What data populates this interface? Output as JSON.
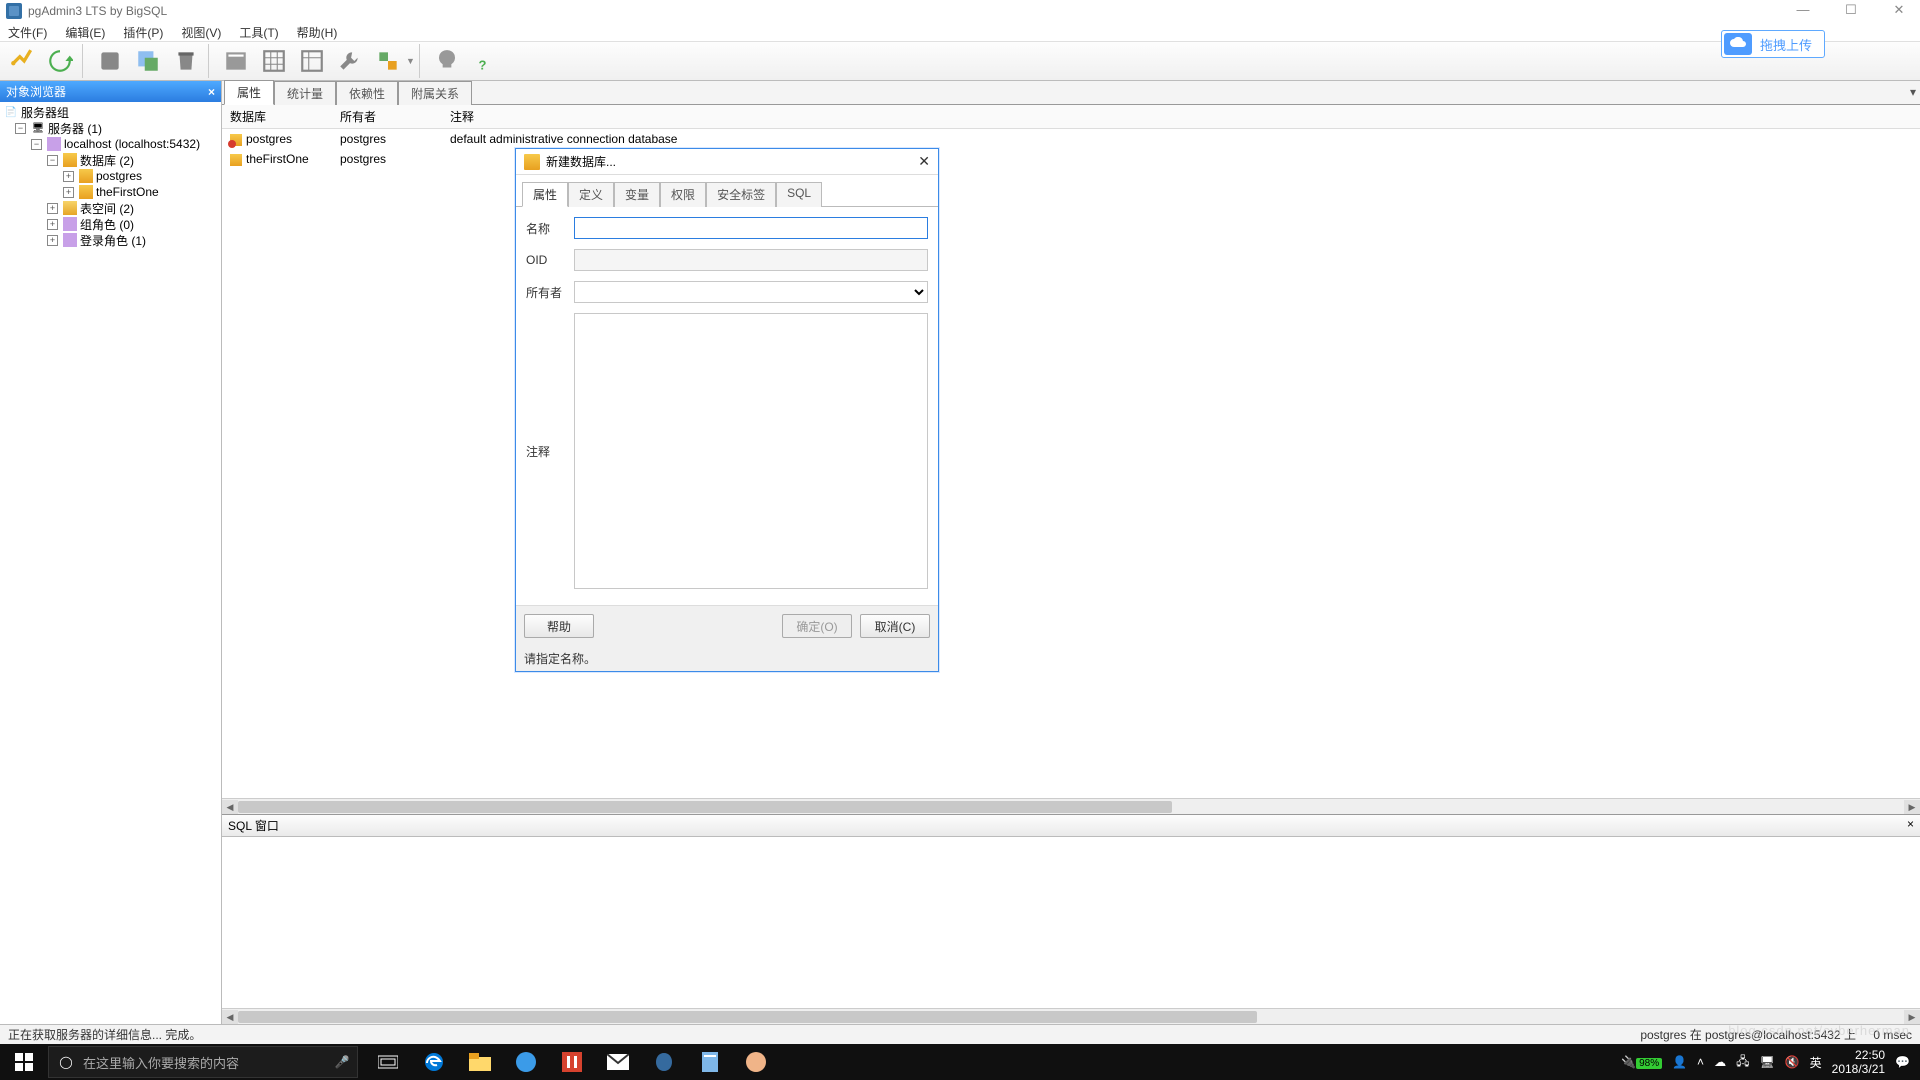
{
  "title": "pgAdmin3 LTS by BigSQL",
  "cloud_upload": "拖拽上传",
  "menubar": [
    "文件(F)",
    "编辑(E)",
    "插件(P)",
    "视图(V)",
    "工具(T)",
    "帮助(H)"
  ],
  "objbrowser": {
    "header": "对象浏览器",
    "root": "服务器组",
    "servers": "服务器 (1)",
    "localhost": "localhost (localhost:5432)",
    "databases": "数据库 (2)",
    "db1": "postgres",
    "db2": "theFirstOne",
    "tablespaces": "表空间 (2)",
    "group_roles": "组角色 (0)",
    "login_roles": "登录角色 (1)"
  },
  "tabs": [
    "属性",
    "统计量",
    "依赖性",
    "附属关系"
  ],
  "grid": {
    "cols": [
      "数据库",
      "所有者",
      "注释"
    ],
    "rows": [
      {
        "db": "postgres",
        "owner": "postgres",
        "comment": "default administrative connection database",
        "red": true
      },
      {
        "db": "theFirstOne",
        "owner": "postgres",
        "comment": "",
        "red": false
      }
    ]
  },
  "sqlpane": {
    "title": "SQL 窗口"
  },
  "status": {
    "left": "正在获取服务器的详细信息... 完成。",
    "conn": "postgres 在  postgres@localhost:5432 上",
    "time": "0 msec"
  },
  "dialog": {
    "title": "新建数据库...",
    "tabs": [
      "属性",
      "定义",
      "变量",
      "权限",
      "安全标签",
      "SQL"
    ],
    "fields": {
      "name": "名称",
      "oid": "OID",
      "owner": "所有者",
      "comment": "注释"
    },
    "buttons": {
      "help": "帮助",
      "ok": "确定(O)",
      "cancel": "取消(C)"
    },
    "status": "请指定名称。"
  },
  "taskbar": {
    "search_placeholder": "在这里输入你要搜索的内容",
    "battery": "98%",
    "ime": "英",
    "time": "22:50",
    "date": "2018/3/21"
  },
  "watermark": "blog.csdn.net/cyberherman"
}
